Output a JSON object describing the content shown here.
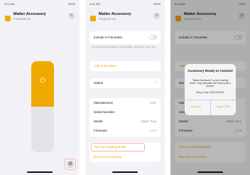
{
  "accent": "#f0a900",
  "highlight": "#f4b7a6",
  "phone1": {
    "time": "9:41 AM",
    "battery": "100%",
    "title": "Matter Accessory",
    "subtitle": "Powered On",
    "close_icon": "×",
    "power_icon": "⏻",
    "settings_icon": "⚙"
  },
  "phone2": {
    "time": "9:41 AM",
    "battery": "100%",
    "title": "Matter Accessory",
    "subtitle": "Powered On",
    "close_icon": "×",
    "favorites_label": "Include in Favorites",
    "favorites_note": "This accessory will appear in Favorites, and in the Home tab.",
    "add_automation": "Add Automation",
    "status_label": "Status",
    "status_chevron": "›",
    "manufacturer_label": "Manufacturer",
    "manufacturer_value": "NXO",
    "serial_label": "Serial Number",
    "model_label": "Model",
    "model_value": "Matter Plug",
    "firmware_label": "Firmware",
    "firmware_value": "1.2.6",
    "pairing_mode": "Turn On Pairing Mode",
    "remove_accessory": "Remove Accessory"
  },
  "phone3": {
    "time": "9:41 AM",
    "battery": "100%",
    "title": "Matter Accessory",
    "subtitle": "Powered On",
    "close_icon": "×",
    "favorites_label": "Include in Favorites",
    "add_automation": "Add Automation",
    "status_label": "Sta",
    "manufacturer_label": "Manufacturer",
    "serial_label": "Serial Number",
    "model_label": "Model",
    "model_value": "Matter Plug",
    "firmware_label": "Firmware",
    "firmware_value": "1.2.6",
    "pairing_mode": "Turn On Pairing Mode",
    "remove_accessory": "Remove Accessory",
    "alert": {
      "title": "Accessory Ready to Connect",
      "message": "\"Matter Accessory\" is now in pairing mode. Copy and paste the Setup code to connect.",
      "code": "Setup Code: 30012023970",
      "dismiss": "Dismiss",
      "copy": "Copy Code"
    }
  }
}
